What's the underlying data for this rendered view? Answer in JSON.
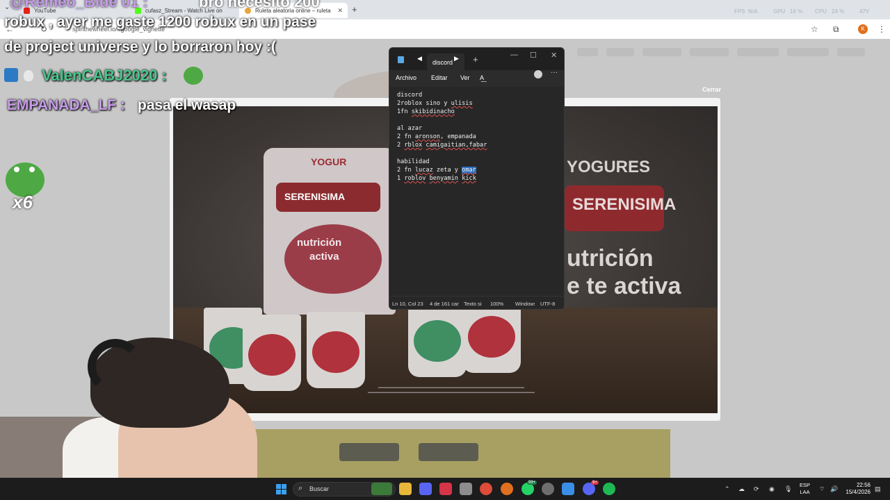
{
  "browser": {
    "tabs": [
      {
        "label": "YouTube",
        "favicon_color": "#e62117"
      },
      {
        "label": "cufasz_Stream - Watch Live on",
        "favicon_color": "#53fc18"
      },
      {
        "label": "Ruleta aleatoria online – ruleta",
        "favicon_color": "#e8a53b",
        "active": true
      }
    ],
    "url": "spinthewheel.io/#google_vignette",
    "perf": {
      "fps_label": "FPS",
      "fps_value": "N/A",
      "gpu_label": "GPU",
      "gpu_value": "16 %",
      "cpu_label": "CPU",
      "cpu_value": "24 %",
      "extra": "47V"
    },
    "profile_initial": "K"
  },
  "page": {
    "close_label": "Cerrar"
  },
  "ad": {
    "headline": "YOGURES",
    "brand": "SERENISIMA",
    "tagline_1": "utrición",
    "tagline_2": "e te activa",
    "bag_text_1": "YOGUR",
    "bag_text_2": "SERENISIMA",
    "bag_text_3": "nutrición",
    "bag_text_4": "activa",
    "cup_colors": [
      "#3f8f63",
      "#b0323c",
      "#b0323c",
      "#3f8f63",
      "#b0323c",
      "#b0323c"
    ]
  },
  "chat": {
    "top_user_cut": "@Remeo_Blde 01 :",
    "top_msg_cut": "bro necesito 200",
    "line1": "robux , ayer me gaste 1200 robux en un pase",
    "line2": "de project universe y lo borraron hoy :(",
    "user1": "ValenCABJ2020 :",
    "user2": "EMPANADA_LF :",
    "msg2": "pasa el wasap",
    "multiplier": "x6"
  },
  "notepad": {
    "tab_title": "discord",
    "menu": [
      "Archivo",
      "Editar",
      "Ver"
    ],
    "status": {
      "position": "Ln 10, Col 23",
      "chars": "4 de 161 caracteres",
      "format": "Texto sin formato",
      "zoom": "100%",
      "eol": "Windows (CRLF)",
      "encoding": "UTF-8"
    }
  },
  "taskbar": {
    "search_placeholder": "Buscar",
    "badge_whatsapp": "99+",
    "badge_discord": "9+",
    "lang_1": "ESP",
    "lang_2": "LAA",
    "time": "22:56",
    "date": "15/4/2026"
  }
}
